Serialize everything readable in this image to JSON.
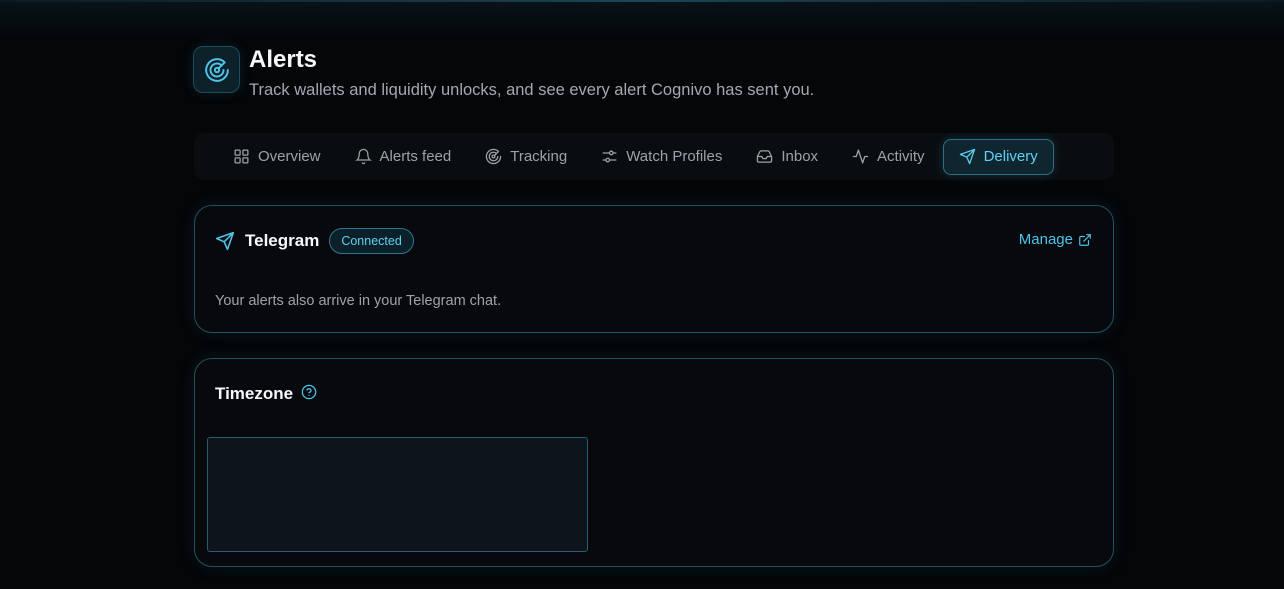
{
  "header": {
    "title": "Alerts",
    "subtitle": "Track wallets and liquidity unlocks, and see every alert Cognivo has sent you.",
    "logo_icon": "radar-icon"
  },
  "tabs": [
    {
      "label": "Overview",
      "icon": "grid-icon",
      "active": false
    },
    {
      "label": "Alerts feed",
      "icon": "bell-icon",
      "active": false
    },
    {
      "label": "Tracking",
      "icon": "radar-icon",
      "active": false
    },
    {
      "label": "Watch Profiles",
      "icon": "sliders-icon",
      "active": false
    },
    {
      "label": "Inbox",
      "icon": "inbox-icon",
      "active": false
    },
    {
      "label": "Activity",
      "icon": "activity-icon",
      "active": false
    },
    {
      "label": "Delivery",
      "icon": "send-icon",
      "active": true
    }
  ],
  "telegram": {
    "title": "Telegram",
    "status": "Connected",
    "manage_label": "Manage",
    "description": "Your alerts also arrive in your Telegram chat."
  },
  "timezone": {
    "title": "Timezone"
  },
  "colors": {
    "accent": "#4fc3ea",
    "background": "#040608",
    "card_border": "#1f5262"
  }
}
